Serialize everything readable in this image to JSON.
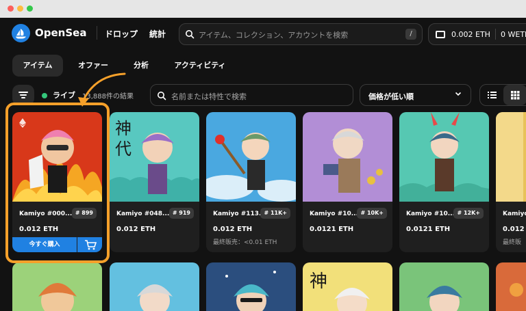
{
  "header": {
    "brand": "OpenSea",
    "nav": [
      "ドロップ",
      "統計"
    ],
    "search_placeholder": "アイテム、コレクション、アカウントを検索",
    "search_shortcut": "/",
    "wallet_eth": "0.002 ETH",
    "wallet_weth": "0 WETH"
  },
  "tabs": [
    {
      "label": "アイテム",
      "active": true
    },
    {
      "label": "オファー",
      "active": false
    },
    {
      "label": "分析",
      "active": false
    },
    {
      "label": "アクティビティ",
      "active": false
    }
  ],
  "filters": {
    "live_label": "ライブ",
    "result_count": "13,888件の結果",
    "trait_search_placeholder": "名前または特性で検索",
    "sort_label": "価格が低い順"
  },
  "colors": {
    "accent": "#2081e2",
    "highlight": "#f5a02a",
    "live": "#34c77b"
  },
  "cards": [
    {
      "name": "Kamiyo #000...",
      "rank": "# 899",
      "price": "0.012 ETH",
      "last_sale": "",
      "buy_label": "今すぐ購入",
      "bg": "#e4461e"
    },
    {
      "name": "Kamiyo #048...",
      "rank": "# 919",
      "price": "0.012 ETH",
      "last_sale": "",
      "bg": "#58c8c0"
    },
    {
      "name": "Kamiyo #113...",
      "rank": "# 11K+",
      "price": "0.012 ETH",
      "last_sale": "最終販売：<0.01 ETH",
      "bg": "#4aa8e0"
    },
    {
      "name": "Kamiyo #10...",
      "rank": "# 10K+",
      "price": "0.0121 ETH",
      "last_sale": "",
      "bg": "#b28ed6"
    },
    {
      "name": "Kamiyo #10...",
      "rank": "# 12K+",
      "price": "0.0121 ETH",
      "last_sale": "",
      "bg": "#56c8b2"
    },
    {
      "name": "Kamiyo",
      "rank": "",
      "price": "0.012",
      "last_sale": "最終販",
      "bg": "#e8c25a"
    }
  ],
  "second_row_bgs": [
    "#9cd27a",
    "#63c0e0",
    "#2b4e7e",
    "#f2e07a",
    "#7ac47a",
    "#d96a3a"
  ]
}
